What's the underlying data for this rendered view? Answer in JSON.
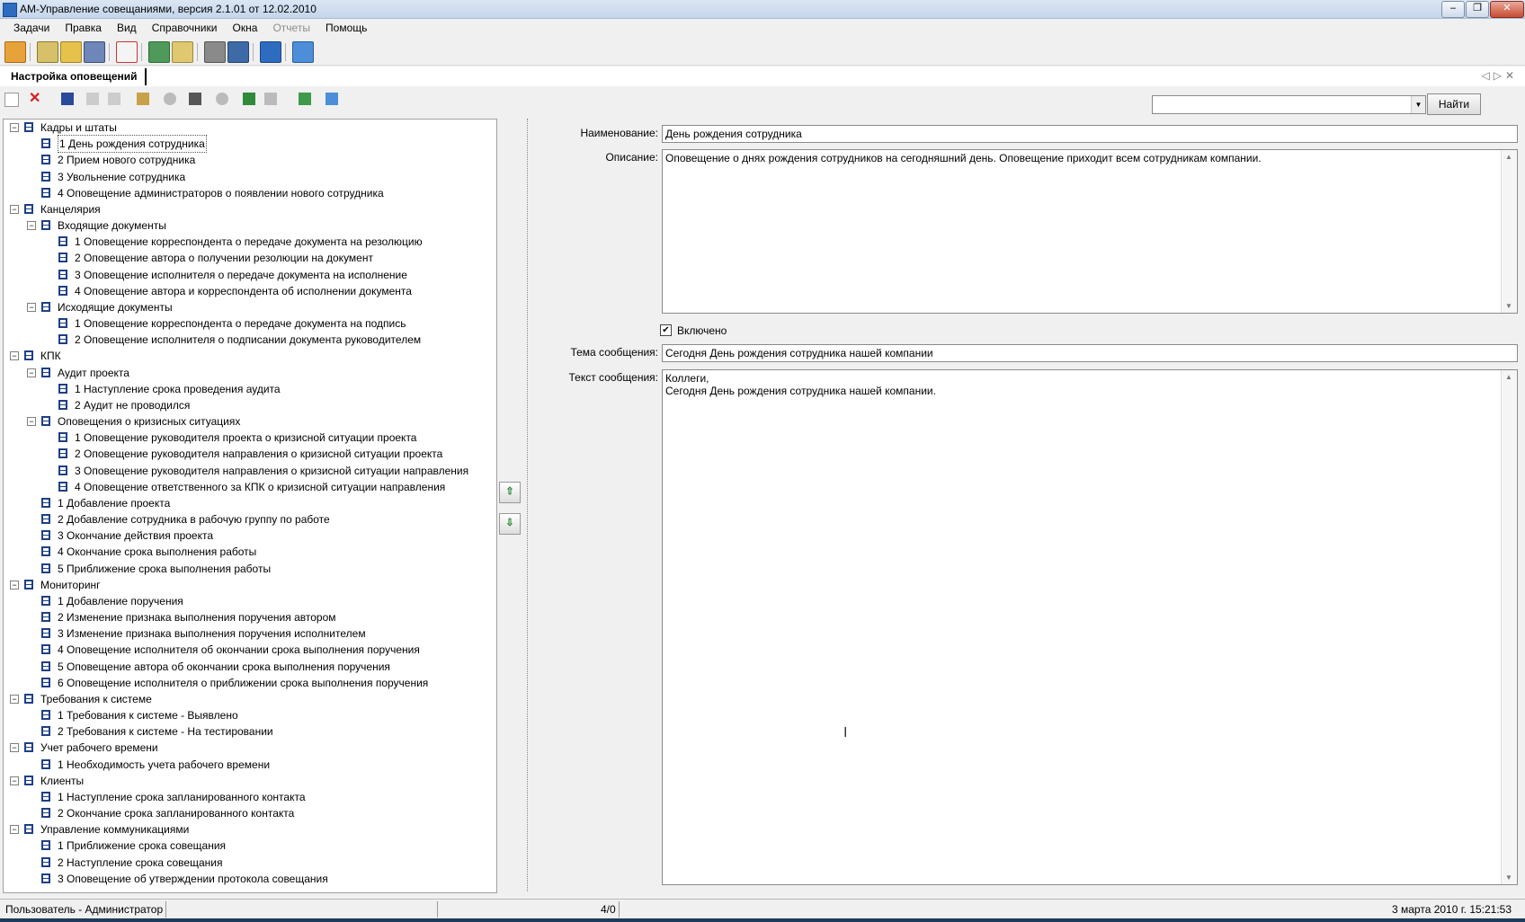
{
  "window": {
    "title": "АМ-Управление совещаниями, версия 2.1.01 от 12.02.2010"
  },
  "menu": [
    {
      "label": "Задачи",
      "enabled": true
    },
    {
      "label": "Правка",
      "enabled": true
    },
    {
      "label": "Вид",
      "enabled": true
    },
    {
      "label": "Справочники",
      "enabled": true
    },
    {
      "label": "Окна",
      "enabled": true
    },
    {
      "label": "Отчеты",
      "enabled": false
    },
    {
      "label": "Помощь",
      "enabled": true
    }
  ],
  "document_tab": {
    "label": "Настройка оповещений"
  },
  "search": {
    "value": "",
    "button_label": "Найти"
  },
  "tree": [
    {
      "level": 0,
      "expanded": true,
      "label": "Кадры и штаты"
    },
    {
      "level": 1,
      "label": "1 День рождения сотрудника",
      "selected": true
    },
    {
      "level": 1,
      "label": "2 Прием нового сотрудника"
    },
    {
      "level": 1,
      "label": "3 Увольнение сотрудника"
    },
    {
      "level": 1,
      "label": "4 Оповещение администраторов о появлении нового сотрудника"
    },
    {
      "level": 0,
      "expanded": true,
      "label": "Канцелярия"
    },
    {
      "level": 1,
      "expanded": true,
      "label": "Входящие документы"
    },
    {
      "level": 2,
      "label": "1 Оповещение корреспондента о передаче документа на резолюцию"
    },
    {
      "level": 2,
      "label": "2 Оповещение автора о получении резолюции на документ"
    },
    {
      "level": 2,
      "label": "3 Оповещение исполнителя о передаче документа на исполнение"
    },
    {
      "level": 2,
      "label": "4 Оповещение автора и корреспондента об исполнении документа"
    },
    {
      "level": 1,
      "expanded": true,
      "label": "Исходящие документы"
    },
    {
      "level": 2,
      "label": "1 Оповещение корреспондента о передаче документа на подпись"
    },
    {
      "level": 2,
      "label": "2 Оповещение исполнителя о подписании документа руководителем"
    },
    {
      "level": 0,
      "expanded": true,
      "label": "КПК"
    },
    {
      "level": 1,
      "expanded": true,
      "label": "Аудит проекта"
    },
    {
      "level": 2,
      "label": "1 Наступление срока проведения аудита"
    },
    {
      "level": 2,
      "label": "2 Аудит не проводился"
    },
    {
      "level": 1,
      "expanded": true,
      "label": "Оповещения о кризисных ситуациях"
    },
    {
      "level": 2,
      "label": "1 Оповещение руководителя проекта о кризисной ситуации проекта"
    },
    {
      "level": 2,
      "label": "2 Оповещение руководителя направления о кризисной ситуации проекта"
    },
    {
      "level": 2,
      "label": "3 Оповещение руководителя направления о кризисной ситуации направления"
    },
    {
      "level": 2,
      "label": "4 Оповещение ответственного за КПК о кризисной ситуации направления"
    },
    {
      "level": 1,
      "label": "1 Добавление проекта"
    },
    {
      "level": 1,
      "label": "2 Добавление сотрудника в рабочую группу по работе"
    },
    {
      "level": 1,
      "label": "3 Окончание действия проекта"
    },
    {
      "level": 1,
      "label": "4 Окончание срока выполнения работы"
    },
    {
      "level": 1,
      "label": "5 Приближение срока выполнения работы"
    },
    {
      "level": 0,
      "expanded": true,
      "label": "Мониторинг"
    },
    {
      "level": 1,
      "label": "1 Добавление поручения"
    },
    {
      "level": 1,
      "label": "2 Изменение признака выполнения поручения автором"
    },
    {
      "level": 1,
      "label": "3 Изменение признака выполнения поручения исполнителем"
    },
    {
      "level": 1,
      "label": "4 Оповещение исполнителя об окончании срока выполнения поручения"
    },
    {
      "level": 1,
      "label": "5 Оповещение автора об окончании срока выполнения поручения"
    },
    {
      "level": 1,
      "label": "6 Оповещение исполнителя о приближении срока выполнения поручения"
    },
    {
      "level": 0,
      "expanded": true,
      "label": "Требования к системе"
    },
    {
      "level": 1,
      "label": "1 Требования к системе - Выявлено"
    },
    {
      "level": 1,
      "label": "2 Требования к системе - На тестировании"
    },
    {
      "level": 0,
      "expanded": true,
      "label": "Учет рабочего времени"
    },
    {
      "level": 1,
      "label": "1 Необходимость учета рабочего времени"
    },
    {
      "level": 0,
      "expanded": true,
      "label": "Клиенты"
    },
    {
      "level": 1,
      "label": "1 Наступление срока запланированного контакта"
    },
    {
      "level": 1,
      "label": "2 Окончание срока запланированного контакта"
    },
    {
      "level": 0,
      "expanded": true,
      "label": "Управление коммуникациями"
    },
    {
      "level": 1,
      "label": "1 Приближение срока совещания"
    },
    {
      "level": 1,
      "label": "2 Наступление срока совещания"
    },
    {
      "level": 1,
      "label": "3 Оповещение об утверждении протокола совещания"
    }
  ],
  "form": {
    "name_label": "Наименование:",
    "name_value": "День рождения сотрудника",
    "description_label": "Описание:",
    "description_value": "Оповещение о днях рождения сотрудников на сегодняшний день. Оповещение приходит всем сотрудникам компании.",
    "enabled_label": "Включено",
    "enabled_checked": true,
    "subject_label": "Тема сообщения:",
    "subject_value": "Сегодня День рождения сотрудника нашей компании",
    "body_label": "Текст сообщения:",
    "body_line1": "Коллеги,",
    "body_line2": "Сегодня День рождения сотрудника нашей  компании."
  },
  "status": {
    "user": "Пользователь - Администратор",
    "counter": "4/0",
    "datetime": "3 марта 2010 г. 15:21:53"
  }
}
